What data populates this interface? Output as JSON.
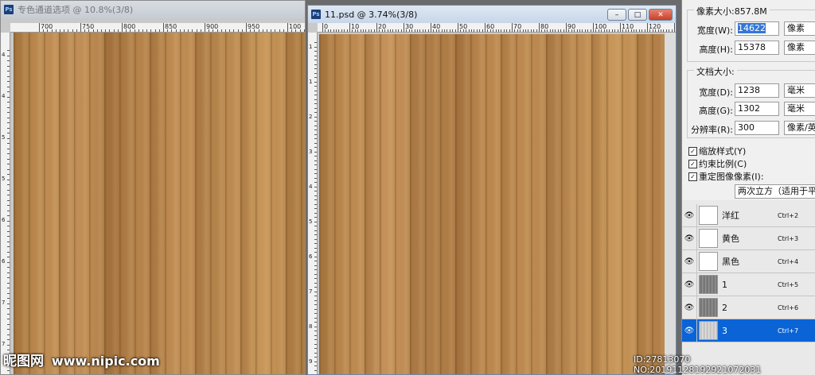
{
  "window1": {
    "title": "专色通道选项 @ 10.8%(3/8)",
    "ruler_labels": [
      "700",
      "750",
      "800",
      "850",
      "900",
      "950",
      "100"
    ],
    "vruler_labels": [
      "4",
      "4",
      "5",
      "5",
      "6",
      "6",
      "7",
      "7"
    ]
  },
  "window2": {
    "title": "11.psd @ 3.74%(3/8)",
    "ruler_labels": [
      "0",
      "10",
      "20",
      "30",
      "40",
      "50",
      "60",
      "70",
      "80",
      "90",
      "100",
      "110",
      "120"
    ],
    "vruler_labels": [
      "1",
      "1",
      "2",
      "3",
      "4",
      "5",
      "6",
      "7",
      "8",
      "9"
    ],
    "minimize": "–",
    "restore": "□",
    "close": "✕"
  },
  "dialog": {
    "pixel_size_label": "像素大小:857.8M",
    "width_label": "宽度(W):",
    "width_value": "14622",
    "width_unit": "像素",
    "height_label": "高度(H):",
    "height_value": "15378",
    "height_unit": "像素",
    "doc_size_label": "文档大小:",
    "doc_width_label": "宽度(D):",
    "doc_width_value": "1238",
    "doc_width_unit": "毫米",
    "doc_height_label": "高度(G):",
    "doc_height_value": "1302",
    "doc_height_unit": "毫米",
    "resolution_label": "分辨率(R):",
    "resolution_value": "300",
    "resolution_unit": "像素/英寸",
    "scale_styles": "缩放样式(Y)",
    "constrain": "约束比例(C)",
    "resample": "重定图像像素(I):",
    "resample_method": "两次立方（适用于平滑渐变）"
  },
  "layers": [
    {
      "name": "洋红",
      "shortcut": "Ctrl+2",
      "thumb": "white",
      "selected": false
    },
    {
      "name": "黄色",
      "shortcut": "Ctrl+3",
      "thumb": "white",
      "selected": false
    },
    {
      "name": "黑色",
      "shortcut": "Ctrl+4",
      "thumb": "white",
      "selected": false
    },
    {
      "name": "1",
      "shortcut": "Ctrl+5",
      "thumb": "gray",
      "selected": false
    },
    {
      "name": "2",
      "shortcut": "Ctrl+6",
      "thumb": "gray",
      "selected": false
    },
    {
      "name": "3",
      "shortcut": "Ctrl+7",
      "thumb": "lightgray",
      "selected": true
    }
  ],
  "watermark": {
    "logo": "昵图网",
    "url": "www.nipic.com",
    "id": "ID:27813070 NO:20191128192921072031"
  },
  "colors": {
    "selected": "#0a64d6",
    "accent": "#c7412c"
  }
}
